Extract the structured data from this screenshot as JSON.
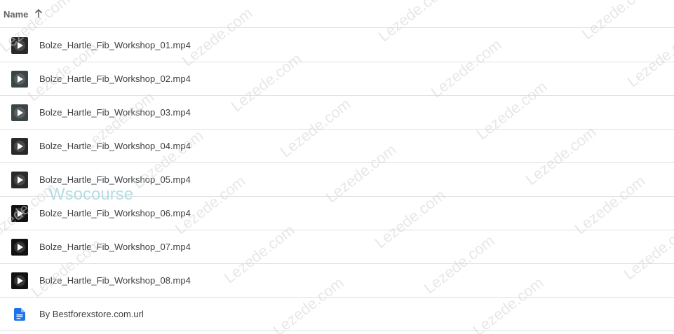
{
  "header": {
    "sort_label": "Name",
    "sort_icon": "arrow-up-icon",
    "sort_direction": "ascending"
  },
  "files": [
    {
      "name": "Bolze_Hartle_Fib_Workshop_01.mp4",
      "type": "video",
      "icon": "video-thumbnail-icon"
    },
    {
      "name": "Bolze_Hartle_Fib_Workshop_02.mp4",
      "type": "video",
      "icon": "video-thumbnail-icon"
    },
    {
      "name": "Bolze_Hartle_Fib_Workshop_03.mp4",
      "type": "video",
      "icon": "video-thumbnail-icon"
    },
    {
      "name": "Bolze_Hartle_Fib_Workshop_04.mp4",
      "type": "video",
      "icon": "video-thumbnail-icon"
    },
    {
      "name": "Bolze_Hartle_Fib_Workshop_05.mp4",
      "type": "video",
      "icon": "video-thumbnail-icon"
    },
    {
      "name": "Bolze_Hartle_Fib_Workshop_06.mp4",
      "type": "video",
      "icon": "video-thumbnail-icon"
    },
    {
      "name": "Bolze_Hartle_Fib_Workshop_07.mp4",
      "type": "video",
      "icon": "video-thumbnail-icon"
    },
    {
      "name": "Bolze_Hartle_Fib_Workshop_08.mp4",
      "type": "video",
      "icon": "video-thumbnail-icon"
    },
    {
      "name": "By Bestforexstore.com.url",
      "type": "document",
      "icon": "document-icon"
    }
  ],
  "watermarks": {
    "repeat_text": "Lezede.com",
    "brand_text": "Wsocourse"
  },
  "colors": {
    "doc_icon_blue": "#1a73e8",
    "divider": "#e0e0e0",
    "text": "#3c4043",
    "header_text": "#5f6368"
  }
}
